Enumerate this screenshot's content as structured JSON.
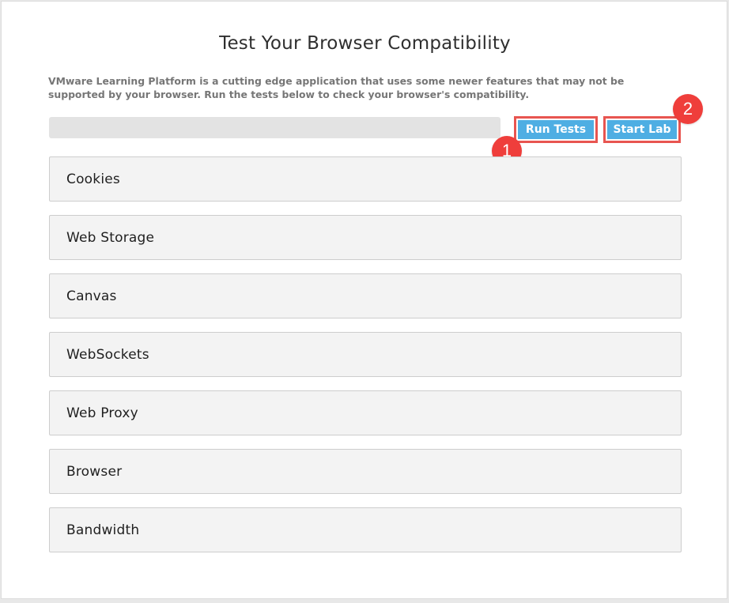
{
  "page": {
    "title": "Test Your Browser Compatibility",
    "intro": "VMware Learning Platform is a cutting edge application that uses some newer features that may not be supported by your browser. Run the tests below to check your browser's compatibility."
  },
  "progress": {
    "value": 0
  },
  "toolbar": {
    "run_tests_label": "Run Tests",
    "start_lab_label": "Start Lab"
  },
  "markers": {
    "one": "1",
    "two": "2"
  },
  "tests": [
    {
      "label": "Cookies"
    },
    {
      "label": "Web Storage"
    },
    {
      "label": "Canvas"
    },
    {
      "label": "WebSockets"
    },
    {
      "label": "Web Proxy"
    },
    {
      "label": "Browser"
    },
    {
      "label": "Bandwidth"
    }
  ],
  "colors": {
    "button": "#4eaee3",
    "highlight_border": "#e85550",
    "marker": "#ef3e3b"
  }
}
